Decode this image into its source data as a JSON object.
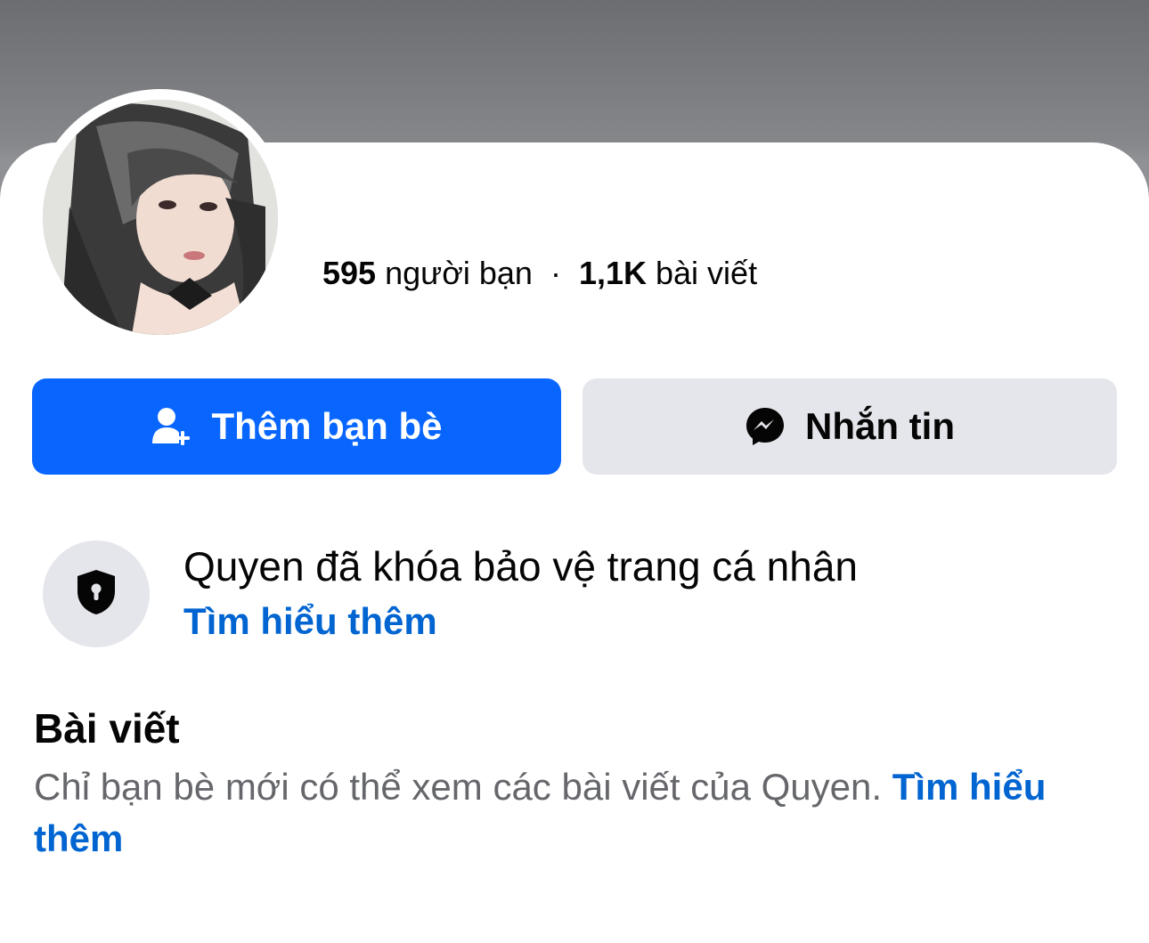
{
  "profile": {
    "name": "",
    "friends_count": "595",
    "friends_label": "người bạn",
    "separator": "·",
    "posts_count": "1,1K",
    "posts_label": "bài viết"
  },
  "actions": {
    "add_friend_label": "Thêm bạn bè",
    "add_friend_icon": "add-friend-icon",
    "message_label": "Nhắn tin",
    "message_icon": "messenger-icon"
  },
  "lock_notice": {
    "icon": "shield-lock-icon",
    "title": "Quyen đã khóa bảo vệ trang cá nhân",
    "link": "Tìm hiểu thêm"
  },
  "posts_section": {
    "title": "Bài viết",
    "description": "Chỉ bạn bè mới có thể xem các bài viết của Quyen.",
    "link": "Tìm hiểu thêm"
  },
  "colors": {
    "primary_button": "#0866ff",
    "secondary_button": "#e4e6eb",
    "link": "#0064d1",
    "secondary_text": "#65676b"
  }
}
